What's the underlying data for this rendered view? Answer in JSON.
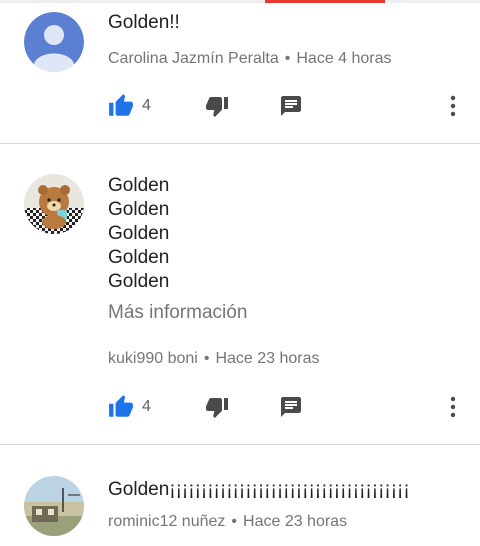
{
  "colors": {
    "like_blue": "#1e73e8",
    "icon_dark": "#4a4a4a",
    "meta_gray": "#757575"
  },
  "comments": [
    {
      "body_lines": [
        "Golden!!"
      ],
      "author": "Carolina Jazmín Peralta",
      "separator": "•",
      "time": "Hace 4 horas",
      "likes": "4",
      "avatar": "default-avatar"
    },
    {
      "body_lines": [
        "Golden",
        "Golden",
        "Golden",
        "Golden",
        "Golden"
      ],
      "more_label": "Más información",
      "author": "kuki990 boni",
      "separator": "•",
      "time": "Hace 23 horas",
      "likes": "4",
      "avatar": "bear-avatar"
    },
    {
      "body_lines": [
        "Golden¡¡¡¡¡¡¡¡¡¡¡¡¡¡¡¡¡¡¡¡¡¡¡¡¡¡¡¡¡¡¡¡¡¡¡¡¡¡"
      ],
      "author": "rominic12 nuñez",
      "separator": "•",
      "time": "Hace 23 horas",
      "avatar": "landscape-avatar"
    }
  ]
}
